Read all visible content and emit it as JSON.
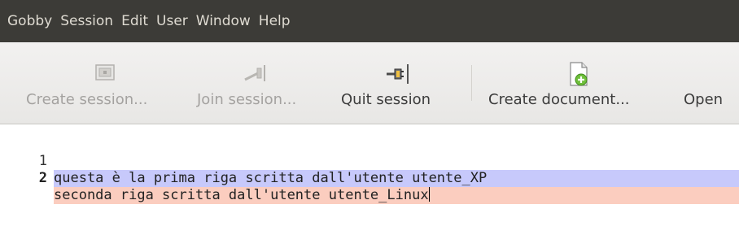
{
  "menubar": {
    "items": [
      "Gobby",
      "Session",
      "Edit",
      "User",
      "Window",
      "Help"
    ]
  },
  "toolbar": {
    "buttons": [
      {
        "label": "Create session...",
        "icon": "create-session-icon",
        "enabled": false
      },
      {
        "label": "Join session...",
        "icon": "join-session-icon",
        "enabled": false
      },
      {
        "label": "Quit session",
        "icon": "quit-session-icon",
        "enabled": true
      },
      {
        "label": "Create document...",
        "icon": "create-document-icon",
        "enabled": true
      },
      {
        "label": "Open",
        "icon": "open-document-icon",
        "enabled": true
      }
    ]
  },
  "editor": {
    "lines": [
      {
        "number": "1",
        "text": "questa è la prima riga scritta dall'utente utente_XP",
        "author_color": "#c7c9fb"
      },
      {
        "number": "2",
        "text": "seconda riga scritta dall'utente utente_Linux",
        "author_color": "#fbcdbf"
      }
    ],
    "current_line": 2
  },
  "colors": {
    "menubar_bg": "#3c3b37",
    "menubar_text": "#dfdbd2",
    "toolbar_bg": "#edeceb"
  }
}
